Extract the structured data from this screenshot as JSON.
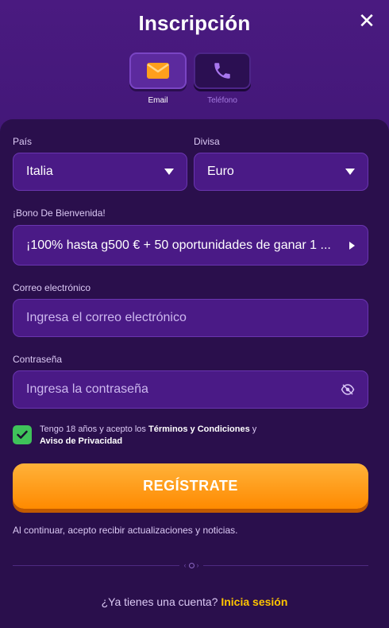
{
  "header": {
    "title": "Inscripción",
    "close_label": "✕"
  },
  "methods": [
    {
      "label": "Email",
      "icon": "envelope-icon",
      "active": true
    },
    {
      "label": "Teléfono",
      "icon": "phone-icon",
      "active": false
    }
  ],
  "form": {
    "country": {
      "label": "País",
      "value": "Italia"
    },
    "currency": {
      "label": "Divisa",
      "value": "Euro"
    },
    "bonus": {
      "label": "¡Bono De Bienvenida!",
      "value": "¡100% hasta g500 € + 50 oportunidades de ganar 1 ..."
    },
    "email": {
      "label": "Correo electrónico",
      "placeholder": "Ingresa el correo electrónico"
    },
    "password": {
      "label": "Contraseña",
      "placeholder": "Ingresa la contraseña"
    },
    "terms": {
      "prefix": "Tengo 18 años y acepto los ",
      "terms_link": "Términos y Condiciones",
      "middle": " y",
      "privacy_link": "Aviso de Privacidad",
      "checked": true
    },
    "submit_label": "REGÍSTRATE",
    "notice": "Al continuar, acepto recibir actualizaciones y noticias."
  },
  "footer": {
    "question": "¿Ya tienes una cuenta? ",
    "login_link": "Inicia sesión"
  },
  "colors": {
    "accent": "#ff9500",
    "link": "#ffc400",
    "check": "#3fc25a",
    "panel": "#2a0f4c"
  }
}
